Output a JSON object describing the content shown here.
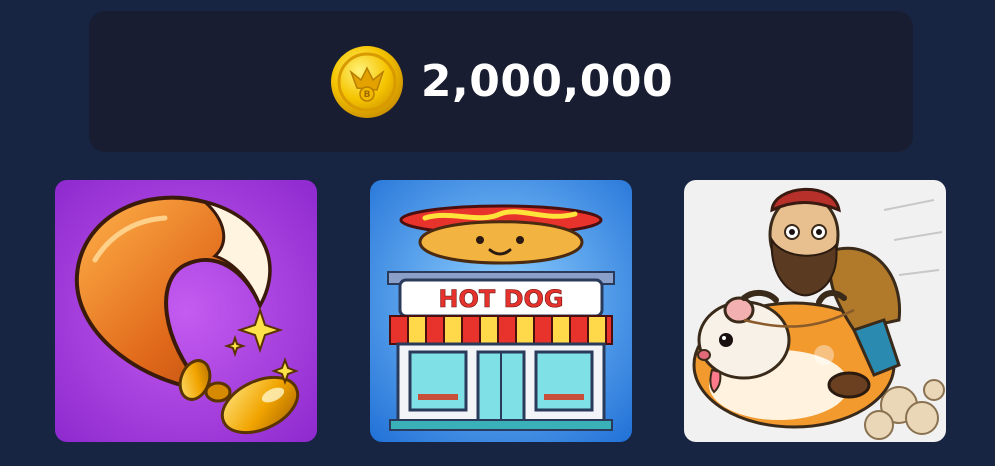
{
  "balance": {
    "icon": "coin-icon",
    "value": "2,000,000",
    "coin_color": "#f5c400"
  },
  "cards": [
    {
      "icon": "fox-tail-illustration",
      "background": "#a43ce0"
    },
    {
      "icon": "hot-dog-shop-illustration",
      "background": "#2d8de8",
      "sign_text": "HOT DOG"
    },
    {
      "icon": "hamster-rider-illustration",
      "background": "#f1f1f1"
    }
  ]
}
